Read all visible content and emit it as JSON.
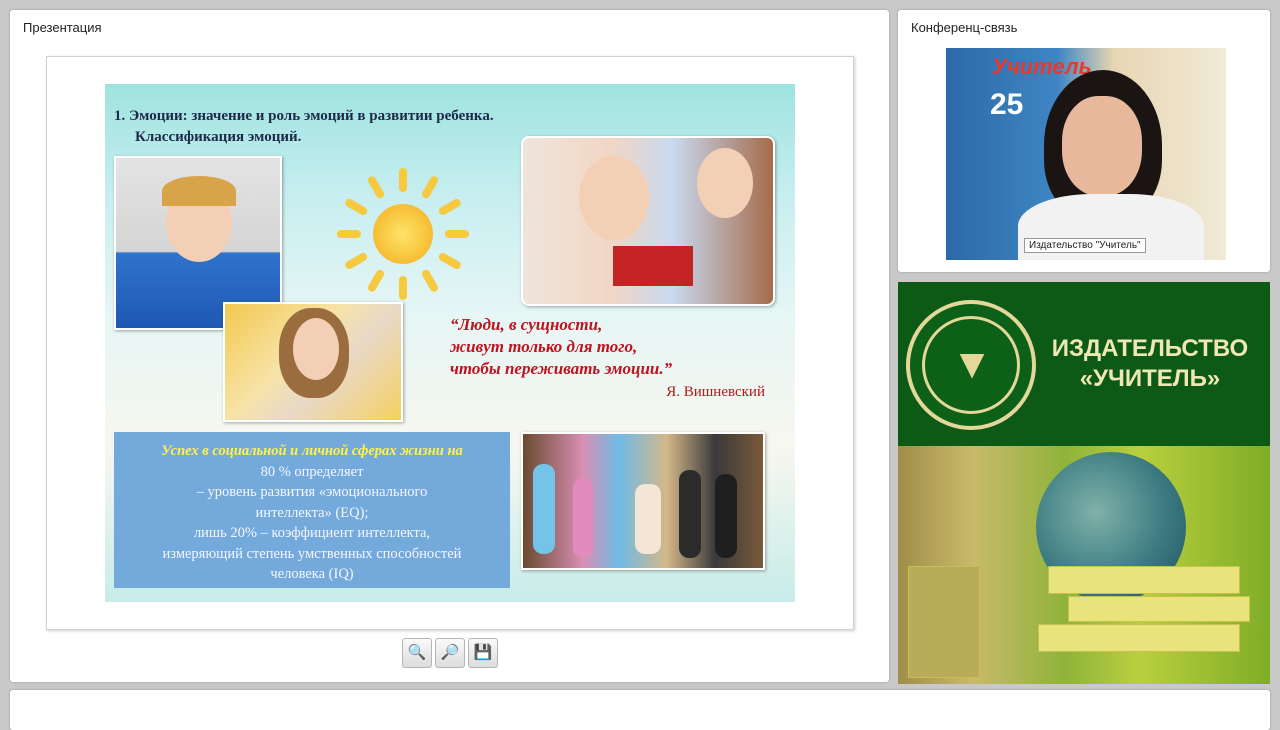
{
  "presentation": {
    "title": "Презентация",
    "slide": {
      "heading_line1": "1. Эмоции: значение и роль эмоций в развитии ребенка.",
      "heading_line2": "Классификация эмоций.",
      "quote_line1": "“Люди, в сущности,",
      "quote_line2": "живут только для того,",
      "quote_line3": "чтобы переживать эмоции.”",
      "quote_author": "Я. Вишневский",
      "box_highlight": "Успех в социальной и личной сферах жизни на",
      "box_line1": "80 % определяет",
      "box_line2": "– уровень развития «эмоционального",
      "box_line3": "интеллекта» (EQ);",
      "box_line4": "лишь 20%  – коэффициент интеллекта,",
      "box_line5": "измеряющий степень умственных способностей",
      "box_line6": "человека (IQ)"
    },
    "toolbar": {
      "zoom_in_icon": "zoom-in-icon",
      "zoom_out_icon": "zoom-out-icon",
      "save_icon": "save-icon"
    }
  },
  "conference": {
    "title": "Конференц-связь",
    "video_label": "Издательство \"Учитель\"",
    "poster_title": "Учитель",
    "poster_number": "25"
  },
  "publisher": {
    "line1": "ИЗДАТЕЛЬСТВО",
    "line2": "«УЧИТЕЛЬ»"
  },
  "colors": {
    "banner": "#0c5a16",
    "quote": "#c0121e",
    "text_box": "#74a9dc",
    "highlight": "#fff24a"
  }
}
